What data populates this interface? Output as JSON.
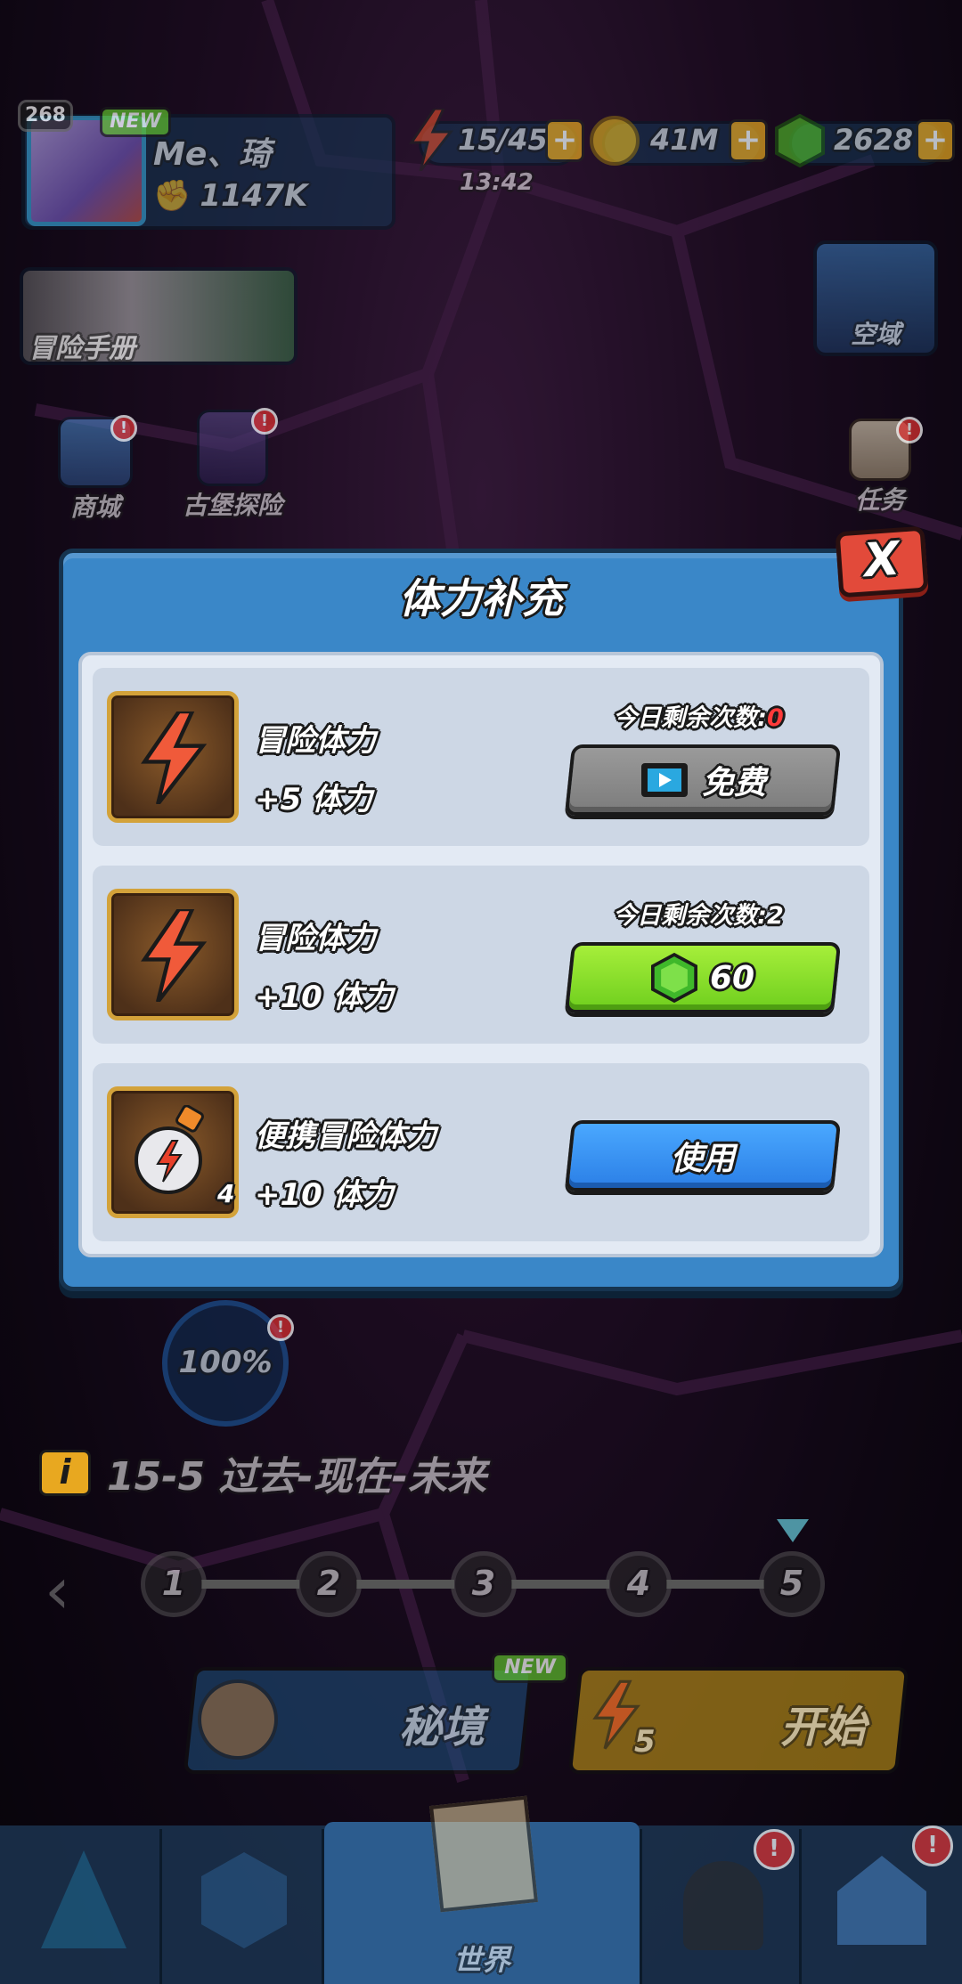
{
  "player": {
    "level": "268",
    "new_badge": "NEW",
    "name": "Me、琦",
    "power": "1147K"
  },
  "resources": {
    "stamina": "15/45",
    "stamina_timer": "13:42",
    "gold": "41M",
    "gems": "2628",
    "plus": "+"
  },
  "side_menu": {
    "manual": "冒险手册",
    "shop": "商城",
    "castle": "古堡探险",
    "skyfield": "空域",
    "tasks": "任务",
    "alert": "!"
  },
  "dialog": {
    "title": "体力补充",
    "close": "X",
    "rows": [
      {
        "name": "冒险体力",
        "value": "+5 体力",
        "remain_label": "今日剩余次数:",
        "remain_count": "0",
        "button": "免费",
        "icon": "stamina-bolt-icon"
      },
      {
        "name": "冒险体力",
        "value": "+10 体力",
        "remain_label": "今日剩余次数:",
        "remain_count": "2",
        "button": "60",
        "icon": "stamina-bolt-icon"
      },
      {
        "name": "便携冒险体力",
        "value": "+10 体力",
        "item_count": "4",
        "button": "使用",
        "icon": "stamina-potion-icon"
      }
    ]
  },
  "stage": {
    "progress": "100%",
    "info_icon": "i",
    "title": "15-5 过去-现在-未来",
    "nodes": [
      "1",
      "2",
      "3",
      "4",
      "5"
    ],
    "current": 5
  },
  "modes": {
    "secret": "秘境",
    "secret_badge": "NEW",
    "start": "开始",
    "start_cost": "5"
  },
  "bottom_nav": {
    "world": "世界"
  },
  "colors": {
    "dialog_bg": "#3a87c8",
    "free_button": "#8a8a8a",
    "gem_button": "#8ee02c",
    "use_button": "#3a95f5",
    "close_button": "#e24a3a",
    "remain_zero": "#ff3a3a"
  }
}
